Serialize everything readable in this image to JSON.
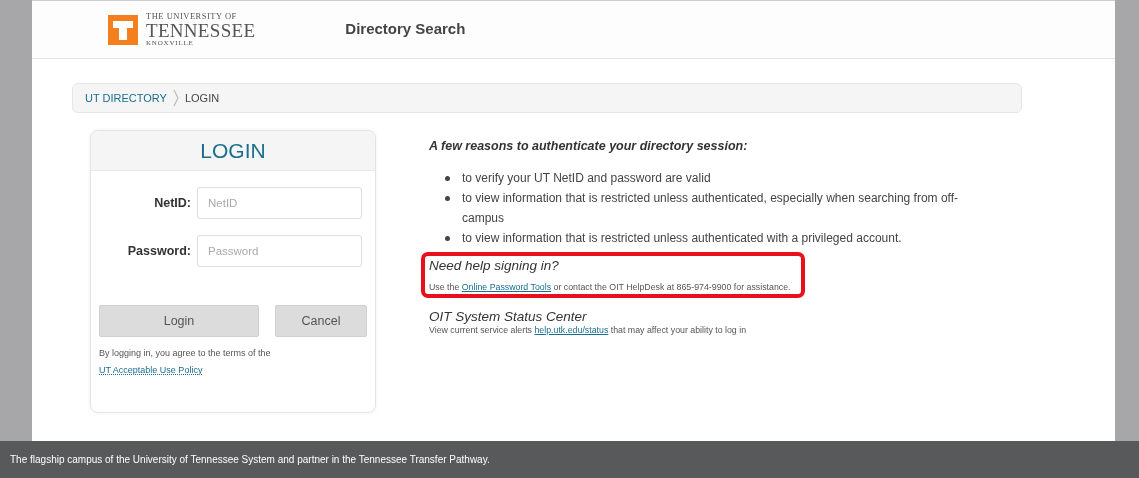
{
  "header": {
    "logo_lines": [
      "THE UNIVERSITY OF",
      "TENNESSEE",
      "KNOXVILLE"
    ],
    "title": "Directory Search"
  },
  "breadcrumb": [
    {
      "label": "UT DIRECTORY",
      "kind": "link"
    },
    {
      "label": "LOGIN",
      "kind": "current"
    }
  ],
  "login": {
    "title": "LOGIN",
    "fields": [
      {
        "label": "NetID:",
        "placeholder": "NetID"
      },
      {
        "label": "Password:",
        "placeholder": "Password"
      }
    ],
    "buttons": [
      "Login",
      "Cancel"
    ],
    "terms": "By logging in, you agree to the terms of the",
    "terms_link": "UT Acceptable Use Policy"
  },
  "info": {
    "heading": "A few reasons to authenticate your directory session:",
    "reasons": [
      "to verify your UT NetID and password are valid",
      "to view information that is restricted unless authenticated, especially when searching from off-campus",
      "to view information that is restricted unless authenticated with a privileged account."
    ],
    "help": {
      "heading": "Need help signing in?",
      "before": "Use the",
      "link": "Online Password Tools",
      "after": "or contact the OIT HelpDesk at 865-974-9900 for assistance.",
      "highlighted": true
    },
    "status": {
      "heading": "OIT System Status Center",
      "before": "View current service alerts",
      "link": "help.utk.edu/status",
      "after": "that may affect your ability to log in"
    }
  },
  "footer": "The flagship campus of the University of Tennessee System and partner in the Tennessee Transfer Pathway."
}
